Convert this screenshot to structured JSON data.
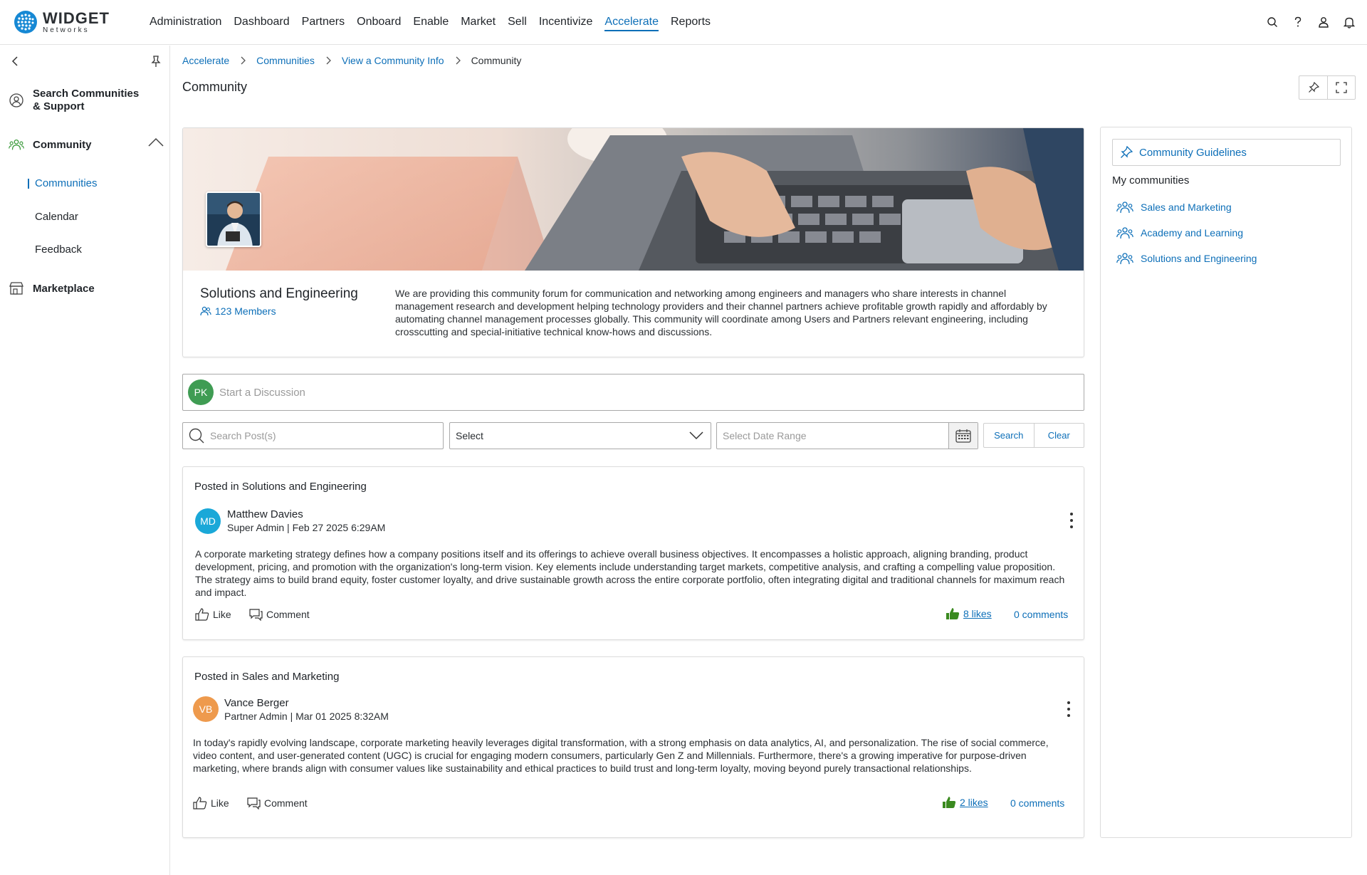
{
  "brand": {
    "name": "WIDGET",
    "sub": "Networks"
  },
  "nav": {
    "items": [
      "Administration",
      "Dashboard",
      "Partners",
      "Onboard",
      "Enable",
      "Market",
      "Sell",
      "Incentivize",
      "Accelerate",
      "Reports"
    ],
    "active": "Accelerate"
  },
  "top_icons": [
    "search-icon",
    "help-icon",
    "user-icon",
    "bell-icon"
  ],
  "sidebar": {
    "search_label": "Search Communities & Support",
    "community_label": "Community",
    "sub_items": [
      "Communities",
      "Calendar",
      "Feedback"
    ],
    "active_sub": "Communities",
    "marketplace_label": "Marketplace"
  },
  "breadcrumb": [
    "Accelerate",
    "Communities",
    "View a Community Info",
    "Community"
  ],
  "page": {
    "title": "Community"
  },
  "community": {
    "name": "Solutions and Engineering",
    "members": "123 Members",
    "description": "We are providing this community forum for communication and networking among engineers and managers who share interests in channel management research and development helping technology providers and their channel partners achieve profitable growth rapidly and affordably by automating channel management processes globally. This community will coordinate among Users and Partners relevant engineering, including crosscutting and special-initiative technical know-hows and discussions."
  },
  "discussion": {
    "initials": "PK",
    "placeholder": "Start a Discussion"
  },
  "filters": {
    "search_placeholder": "Search Post(s)",
    "select_value": "Select",
    "date_placeholder": "Select Date Range",
    "search_button": "Search",
    "clear_button": "Clear"
  },
  "posts": [
    {
      "posted_in": "Posted in Solutions and Engineering",
      "initials": "MD",
      "avatar_color": "#1aa8d8",
      "author": "Matthew Davies",
      "meta": "Super Admin | Feb 27 2025 6:29AM",
      "body": "A corporate marketing strategy defines how a company positions itself and its offerings to achieve overall business objectives. It encompasses a holistic approach, aligning branding, product development, pricing, and promotion with the organization's long-term vision. Key elements include understanding target markets, competitive analysis, and crafting a compelling value proposition. The strategy aims to build brand equity, foster customer loyalty, and drive sustainable growth across the entire corporate portfolio, often integrating digital and traditional channels for maximum reach and impact.",
      "like_label": "Like",
      "comment_label": "Comment",
      "likes": "8 likes",
      "comments": "0 comments"
    },
    {
      "posted_in": "Posted in Sales and Marketing",
      "initials": "VB",
      "avatar_color": "#ee9a4d",
      "author": "Vance Berger",
      "meta": "Partner Admin | Mar 01 2025 8:32AM",
      "body": "In today's rapidly evolving landscape, corporate marketing heavily leverages digital transformation, with a strong emphasis on data analytics, AI, and personalization. The rise of social commerce, video content, and user-generated content (UGC) is crucial for engaging modern consumers, particularly Gen Z and Millennials. Furthermore, there's a growing imperative for purpose-driven marketing, where brands align with consumer values like sustainability and ethical practices to build trust and long-term loyalty, moving beyond purely transactional relationships.",
      "like_label": "Like",
      "comment_label": "Comment",
      "likes": "2 likes",
      "comments": "0 comments"
    }
  ],
  "right_panel": {
    "guidelines": "Community Guidelines",
    "my_communities_title": "My communities",
    "communities": [
      "Sales and Marketing",
      "Academy and Learning",
      "Solutions and Engineering"
    ]
  },
  "colors": {
    "accent": "#0d6fb8",
    "like_green": "#3a8a1f",
    "pk_green": "#3f9c53"
  }
}
